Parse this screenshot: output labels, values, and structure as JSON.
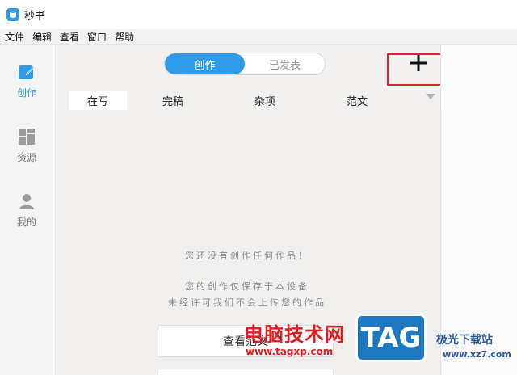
{
  "window": {
    "title": "秒书"
  },
  "menu": [
    "文件",
    "编辑",
    "查看",
    "窗口",
    "帮助"
  ],
  "sidebar": {
    "items": [
      {
        "label": "创作",
        "icon": "create-icon"
      },
      {
        "label": "资源",
        "icon": "resource-grid-icon"
      },
      {
        "label": "我的",
        "icon": "user-icon"
      }
    ]
  },
  "toggle": {
    "left": "创作",
    "right": "已发表"
  },
  "tabs": [
    "在写",
    "完稿",
    "杂项",
    "范文"
  ],
  "empty": {
    "line1": "您还没有创作任何作品！",
    "line2": "您的创作仅保存于本设备",
    "line3": "未经许可我们不会上传您的作品"
  },
  "view_button": "查看范文",
  "watermark": {
    "main": "电脑技术网",
    "url": "www.tagxp.com",
    "tag": "TAG",
    "site": "极光下载站",
    "site_url": "www.xz7.com"
  },
  "colors": {
    "accent": "#2f9be8",
    "highlight": "#e8202a"
  }
}
